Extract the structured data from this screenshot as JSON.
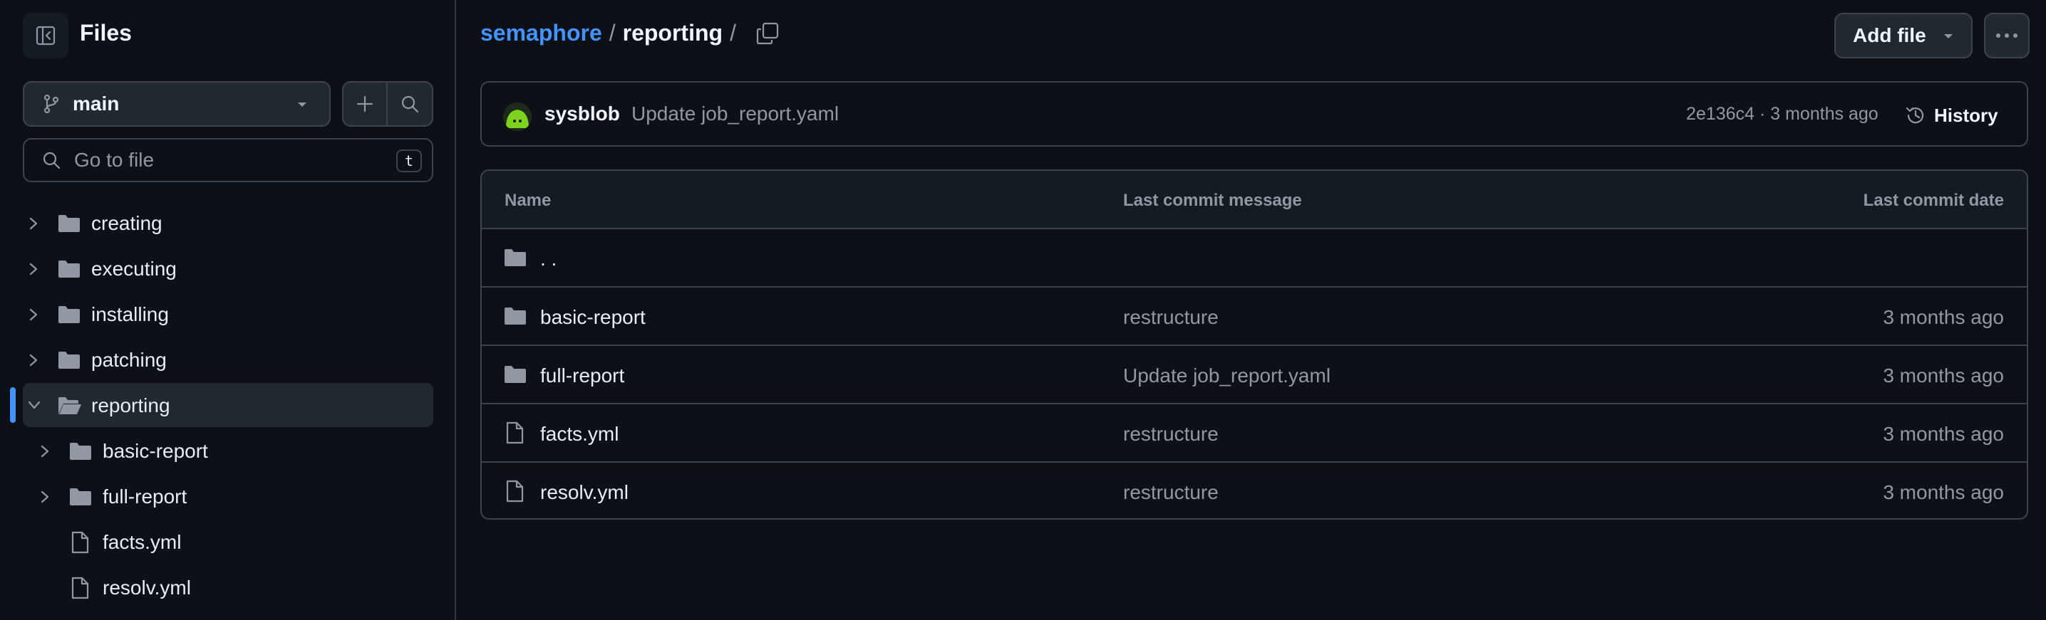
{
  "sidebar": {
    "title": "Files",
    "branch": "main",
    "goto_placeholder": "Go to file",
    "goto_shortcut": "t",
    "tree": [
      {
        "label": "creating",
        "type": "folder",
        "expanded": false,
        "depth": 0
      },
      {
        "label": "executing",
        "type": "folder",
        "expanded": false,
        "depth": 0
      },
      {
        "label": "installing",
        "type": "folder",
        "expanded": false,
        "depth": 0
      },
      {
        "label": "patching",
        "type": "folder",
        "expanded": false,
        "depth": 0
      },
      {
        "label": "reporting",
        "type": "folder",
        "expanded": true,
        "depth": 0,
        "active": true
      },
      {
        "label": "basic-report",
        "type": "folder",
        "expanded": false,
        "depth": 1
      },
      {
        "label": "full-report",
        "type": "folder",
        "expanded": false,
        "depth": 1
      },
      {
        "label": "facts.yml",
        "type": "file",
        "depth": 1
      },
      {
        "label": "resolv.yml",
        "type": "file",
        "depth": 1
      }
    ]
  },
  "header": {
    "repo": "semaphore",
    "sep1": "/",
    "current": "reporting",
    "sep2": "/",
    "add_file_label": "Add file"
  },
  "commit": {
    "author": "sysblob",
    "message": "Update job_report.yaml",
    "meta": "2e136c4 · 3 months ago",
    "history_label": "History"
  },
  "table": {
    "columns": [
      "Name",
      "Last commit message",
      "Last commit date"
    ],
    "parent_label": ". .",
    "rows": [
      {
        "name": "basic-report",
        "type": "folder",
        "message": "restructure",
        "date": "3 months ago"
      },
      {
        "name": "full-report",
        "type": "folder",
        "message": "Update job_report.yaml",
        "date": "3 months ago"
      },
      {
        "name": "facts.yml",
        "type": "file",
        "message": "restructure",
        "date": "3 months ago"
      },
      {
        "name": "resolv.yml",
        "type": "file",
        "message": "restructure",
        "date": "3 months ago"
      }
    ]
  },
  "colors": {
    "background": "#0d1117",
    "accent": "#4493f8",
    "border": "#3d444d",
    "muted_text": "#9198a1"
  }
}
